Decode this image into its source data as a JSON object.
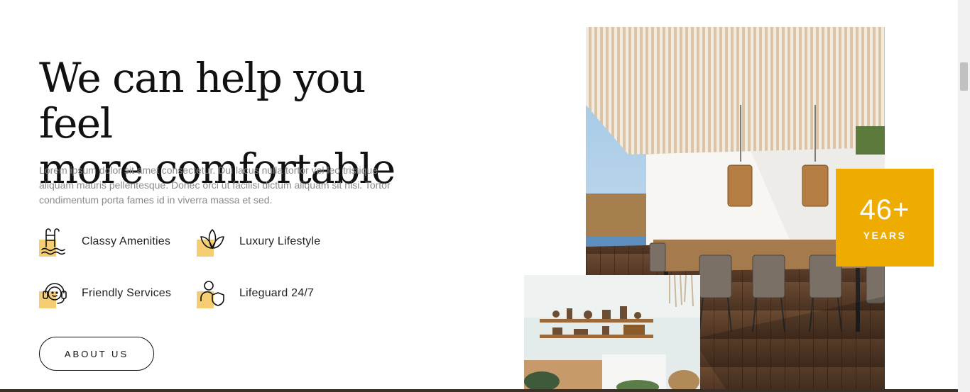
{
  "hero": {
    "title_line1": "We can help you feel",
    "title_line2": "more comfortable",
    "description": "Lorem ipsum dolor sit amet consectetur. Dui lacus nulla tortor vel leo tristique aliquam mauris pellentesque. Donec orci ut facilisi dictum aliquam sit nisi. Tortor condimentum porta fames id in viverra massa et sed."
  },
  "features": [
    {
      "label": "Classy Amenities",
      "icon": "pool-ladder-icon"
    },
    {
      "label": "Luxury Lifestyle",
      "icon": "lotus-icon"
    },
    {
      "label": "Friendly Services",
      "icon": "headset-icon"
    },
    {
      "label": "Lifeguard 24/7",
      "icon": "person-shield-icon"
    }
  ],
  "cta": {
    "label": "ABOUT US"
  },
  "badge": {
    "number": "46+",
    "label": "YEARS"
  },
  "colors": {
    "accent": "#eeac00",
    "icon_bg": "#f3c65a",
    "text": "#111111",
    "muted": "#8a8a8a"
  }
}
